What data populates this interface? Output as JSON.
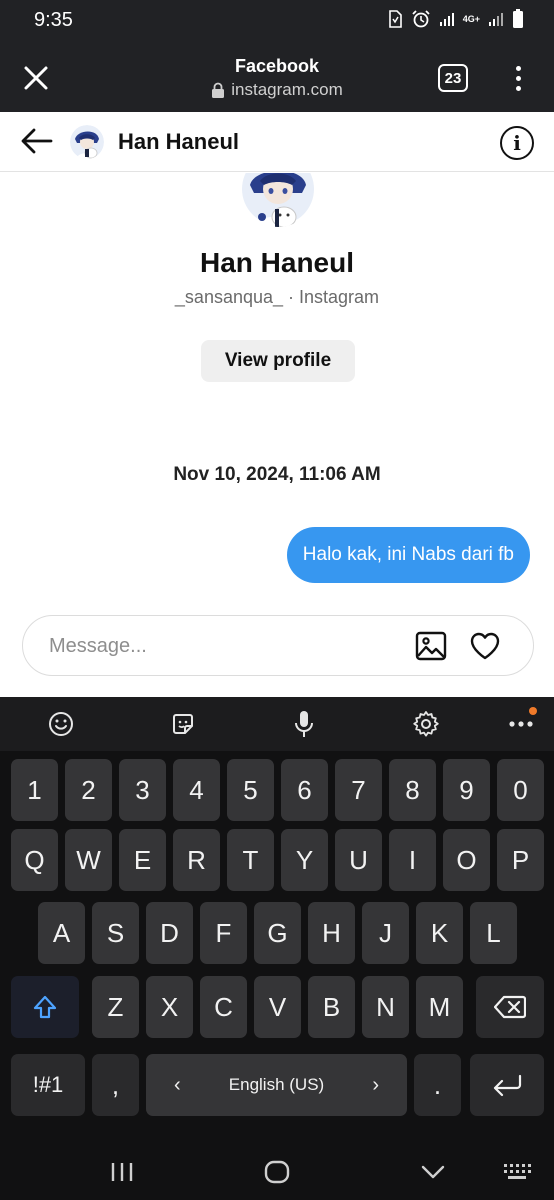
{
  "status_bar": {
    "time": "9:35",
    "network": "4G+"
  },
  "browser": {
    "title": "Facebook",
    "url": "instagram.com",
    "tab_count": "23"
  },
  "chat": {
    "header_name": "Han Haneul",
    "profile_name": "Han Haneul",
    "profile_sub": "_sansanqua_ · Instagram",
    "view_profile_label": "View profile",
    "timestamp": "Nov 10, 2024, 11:06 AM",
    "message": "Halo kak, ini Nabs dari fb",
    "composer_placeholder": "Message..."
  },
  "keyboard": {
    "number_row": [
      "1",
      "2",
      "3",
      "4",
      "5",
      "6",
      "7",
      "8",
      "9",
      "0"
    ],
    "row1": [
      "Q",
      "W",
      "E",
      "R",
      "T",
      "Y",
      "U",
      "I",
      "O",
      "P"
    ],
    "row2": [
      "A",
      "S",
      "D",
      "F",
      "G",
      "H",
      "J",
      "K",
      "L"
    ],
    "row3": [
      "Z",
      "X",
      "C",
      "V",
      "B",
      "N",
      "M"
    ],
    "symbols_label": "!#1",
    "comma": ",",
    "period": ".",
    "language": "English (US)",
    "lang_prev": "‹",
    "lang_next": "›"
  },
  "colors": {
    "bubble": "#3797f0",
    "system_bar": "#212225",
    "keyboard_bg": "#111112",
    "key_bg": "#353537",
    "notification_dot": "#f07a2a"
  }
}
